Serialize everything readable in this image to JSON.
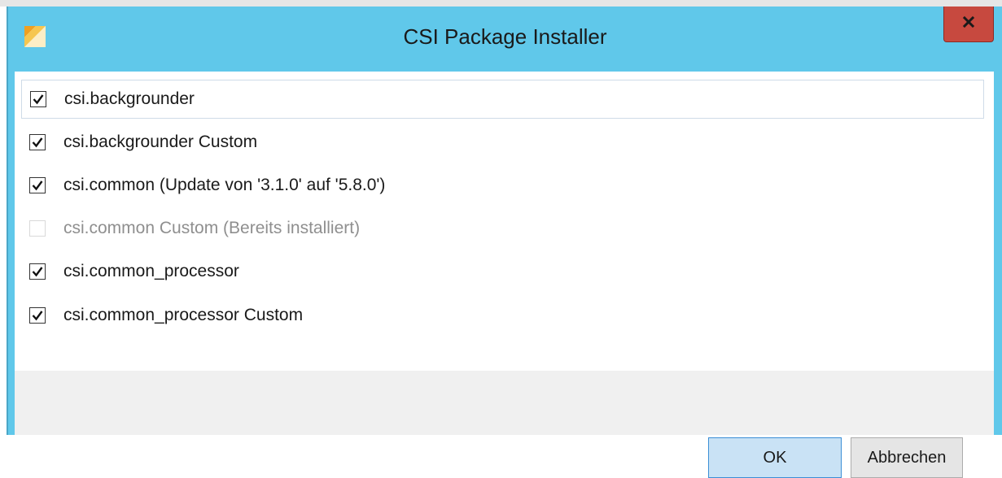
{
  "window": {
    "title": "CSI Package Installer",
    "close_label": "X",
    "accent_color": "#60c8ea",
    "close_color": "#c7493f",
    "icon": "app-logo-icon"
  },
  "packages": [
    {
      "label": "csi.backgrounder",
      "checked": true,
      "disabled": false
    },
    {
      "label": "csi.backgrounder Custom",
      "checked": true,
      "disabled": false
    },
    {
      "label": "csi.common (Update von '3.1.0' auf '5.8.0')",
      "checked": true,
      "disabled": false
    },
    {
      "label": "csi.common Custom (Bereits installiert)",
      "checked": false,
      "disabled": true
    },
    {
      "label": "csi.common_processor",
      "checked": true,
      "disabled": false
    },
    {
      "label": "csi.common_processor Custom",
      "checked": true,
      "disabled": false
    }
  ],
  "buttons": {
    "ok_label": "OK",
    "cancel_label": "Abbrechen"
  }
}
